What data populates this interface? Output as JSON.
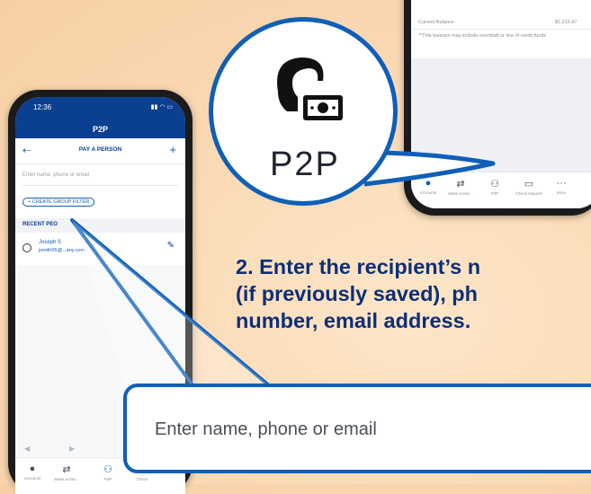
{
  "left_phone": {
    "status_time": "12:36",
    "title": "P2P",
    "nav_label": "PAY A PERSON",
    "search_placeholder": "Enter name, phone or email",
    "filter_label": "+ CREATE GROUP FILTER",
    "section_label": "RECENT PEO",
    "contact_name": "Joseph S",
    "contact_email": "jsmith05@...any.com",
    "tabs": [
      "Accounts",
      "Make a tran...",
      "P2P",
      "Check"
    ]
  },
  "right_phone": {
    "balance_label": "Current Balance",
    "balance_value": "$1,216.87",
    "note": "**This balance may include overdraft or line of credit funds",
    "tabs": [
      "Accounts",
      "Make a tran...",
      "P2P",
      "Check Deposit",
      "More"
    ]
  },
  "callout": {
    "label": "P2P",
    "icon": "person-with-money-icon"
  },
  "instruction": {
    "line1": "2. Enter the recipient’s n",
    "line2": "(if previously saved), ph",
    "line3": "number, email address."
  },
  "zoomed_input": {
    "placeholder": "Enter name, phone or email"
  },
  "colors": {
    "brand": "#0b3f8f",
    "accent": "#0f5fb8",
    "headline": "#0d2f78"
  }
}
